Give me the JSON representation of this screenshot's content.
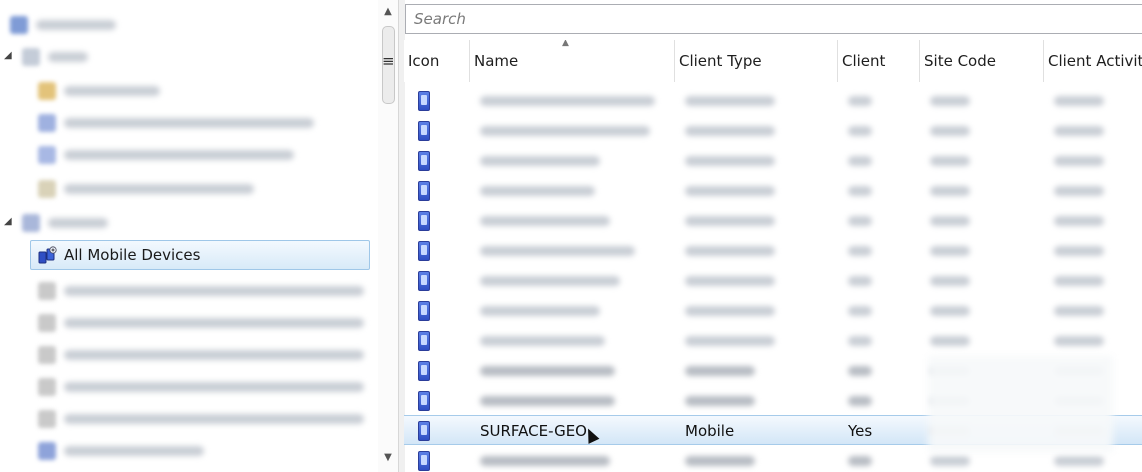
{
  "tree": {
    "selected_label": "All Mobile Devices"
  },
  "search": {
    "placeholder": "Search"
  },
  "grid": {
    "columns": [
      "Icon",
      "Name",
      "Client Type",
      "Client",
      "Site Code",
      "Client Activity"
    ],
    "selected_row": {
      "name": "SURFACE-GEO",
      "client_type": "Mobile",
      "client": "Yes"
    }
  },
  "icons": {
    "device": "mobile-device-icon",
    "collection": "mobile-collection-icon"
  },
  "colors": {
    "selection_top": "#f4f9fe",
    "selection_bottom": "#d3e6f7",
    "selection_border": "#a6cbea",
    "device_icon": "#2f4fc4"
  }
}
